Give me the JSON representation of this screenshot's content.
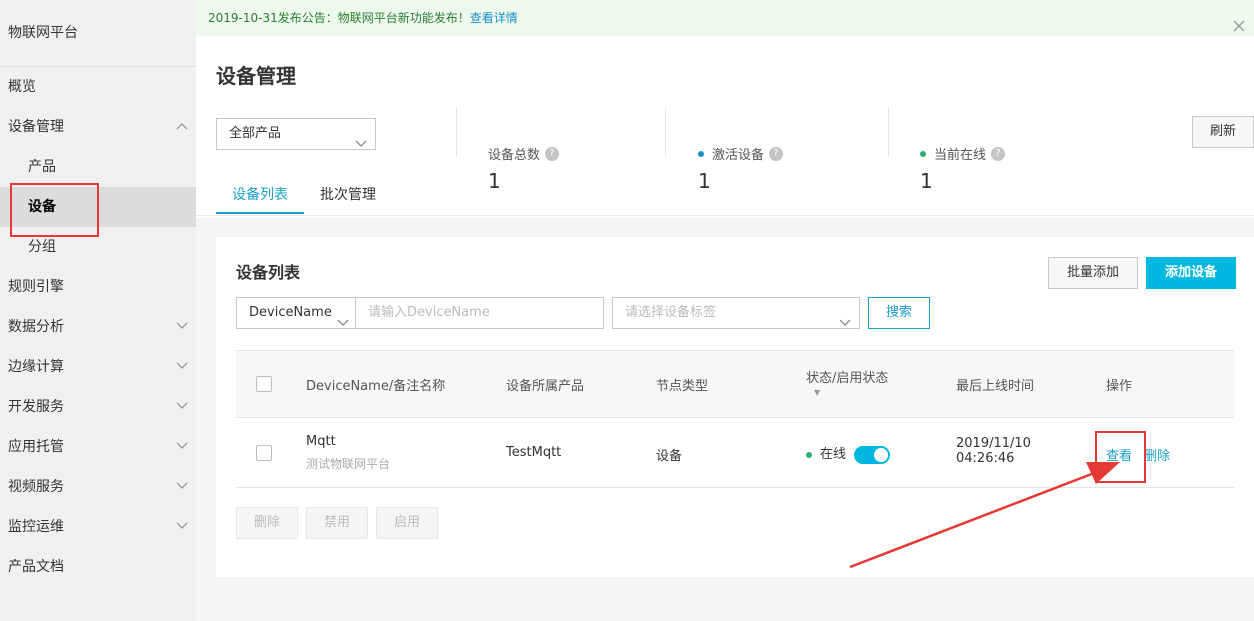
{
  "sidebar": {
    "brand": "物联网平台",
    "items": [
      {
        "label": "概览"
      },
      {
        "label": "设备管理"
      },
      {
        "label": "产品"
      },
      {
        "label": "设备"
      },
      {
        "label": "分组"
      },
      {
        "label": "规则引擎"
      },
      {
        "label": "数据分析"
      },
      {
        "label": "边缘计算"
      },
      {
        "label": "开发服务"
      },
      {
        "label": "应用托管"
      },
      {
        "label": "视频服务"
      },
      {
        "label": "监控运维"
      },
      {
        "label": "产品文档"
      }
    ]
  },
  "notice": {
    "text": "2019-10-31发布公告：物联网平台新功能发布！",
    "link": "查看详情"
  },
  "header": {
    "title": "设备管理",
    "product_select": "全部产品",
    "stats": [
      {
        "label": "设备总数",
        "value": "1"
      },
      {
        "label": "激活设备",
        "value": "1",
        "color": "#1a8fc9"
      },
      {
        "label": "当前在线",
        "value": "1",
        "color": "#27b06e"
      }
    ],
    "refresh": "刷新",
    "tabs": [
      {
        "label": "设备列表"
      },
      {
        "label": "批次管理"
      }
    ]
  },
  "card": {
    "title": "设备列表",
    "batch_add": "批量添加",
    "add_device": "添加设备",
    "filter_field": "DeviceName",
    "filter_placeholder": "请输入DeviceName",
    "tag_placeholder": "请选择设备标签",
    "search": "搜索",
    "columns": [
      "DeviceName/备注名称",
      "设备所属产品",
      "节点类型",
      "状态/启用状态",
      "最后上线时间",
      "操作"
    ],
    "rows": [
      {
        "name": "Mqtt",
        "note": "测试物联网平台",
        "product": "TestMqtt",
        "node": "设备",
        "status": "在线",
        "last_online_date": "2019/11/10",
        "last_online_time": "04:26:46",
        "view": "查看",
        "delete": "删除"
      }
    ],
    "bulk_delete": "删除",
    "bulk_disable": "禁用",
    "bulk_enable": "启用"
  },
  "colors": {
    "accent": "#00b7e0",
    "link": "#1aa0c9",
    "annotation": "#e53935",
    "online": "#27b06e"
  }
}
